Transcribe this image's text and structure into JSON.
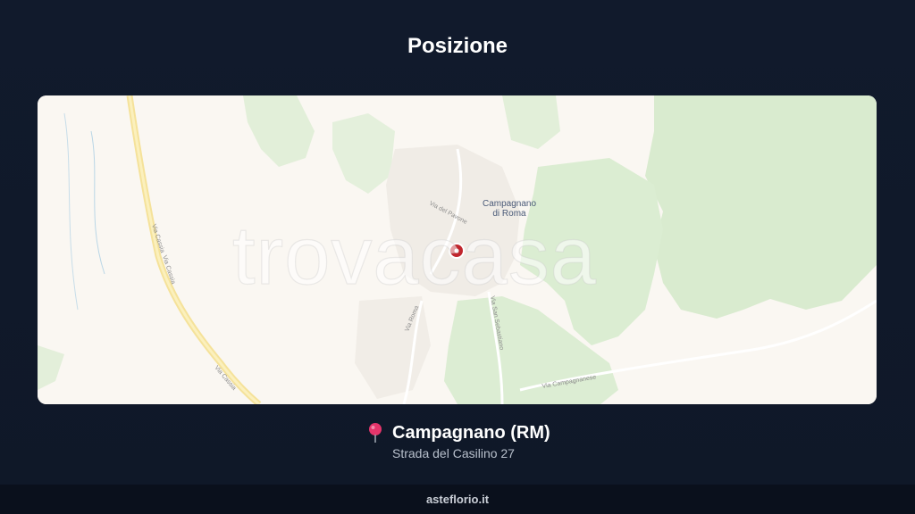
{
  "header": {
    "title": "Posizione"
  },
  "map": {
    "watermark": "trovacasa",
    "town_label_line1": "Campagnano",
    "town_label_line2": "di Roma",
    "streets": {
      "via_cassia_1": "Via Cassia",
      "via_cassia_2": "Via Cassia",
      "via_cassia_3": "Via Cassia",
      "via_del_pavone": "Via del Pavone",
      "via_roma": "Via Roma",
      "via_san_sebastiano": "Via San Sebastiano",
      "via_campagnanese": "Via Campagnanese"
    },
    "colors": {
      "land": "#faf7f2",
      "woods": "#dfeed6",
      "road_major": "#f7e7a0",
      "pin": "#c0262d"
    }
  },
  "location": {
    "pin_icon": "map-pin-icon",
    "city": "Campagnano (RM)",
    "address": "Strada del Casilino 27"
  },
  "footer": {
    "site": "asteflorio.it"
  }
}
